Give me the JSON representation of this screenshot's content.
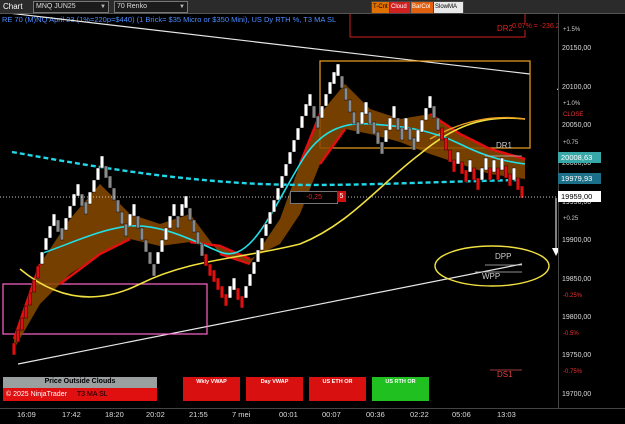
{
  "topbar": {
    "chart_tab": "Chart",
    "instrument": "MNQ JUN25",
    "bar_type": "70 Renko",
    "toolbar_buttons": [
      {
        "label": "T-Cnt",
        "bg": "#e07000",
        "fg": "#000"
      },
      {
        "label": "Cloud",
        "bg": "#d02020",
        "fg": "#fff"
      },
      {
        "label": "BarCol",
        "bg": "#e06010",
        "fg": "#fff"
      },
      {
        "label": "SlowMA",
        "bg": "#e8e8e8",
        "fg": "#000"
      }
    ]
  },
  "subtitle": "RE 70 (M)NQ April 23 (1%=220p=$440) (1 Brick= $35 Micro or $350 Mini), US Dy RTH %, T3 MA SL",
  "top_right": {
    "label": "0.07% = -236.25",
    "dr2": "DR2"
  },
  "price_axis": {
    "labels": [
      "20150,00",
      "20100,00",
      "20050,00",
      "20000,00",
      "19950,00",
      "19900,00",
      "19850,00",
      "19800,00",
      "19750,00",
      "19700,00"
    ]
  },
  "pct_labels": {
    "green": [
      "+1.5%",
      "+1.0%",
      "+0.75",
      "+0.5",
      "+0.25"
    ],
    "red": [
      "-0.25%",
      "-0.5%",
      "-0.75%"
    ],
    "close": "CLOSE"
  },
  "price_boxes": [
    {
      "value": "20008,63",
      "bg": "#37a7a7"
    },
    {
      "value": "19979,93",
      "bg": "#1b6f86"
    },
    {
      "value": "19959,00",
      "bg": "#ffffff",
      "fg": "#000"
    }
  ],
  "levels": {
    "dr1": "DR1",
    "dpp": "DPP",
    "wpp": "WPP",
    "ds1": "DS1"
  },
  "marker": {
    "value": "-0,25",
    "num": "5"
  },
  "time_axis": [
    "16:09",
    "17:42",
    "18:20",
    "20:02",
    "21:55",
    "7 mei",
    "00:01",
    "00:07",
    "00:36",
    "02:22",
    "05:06",
    "13:03"
  ],
  "panels": [
    {
      "label": "Price Outside Clouds",
      "bg": "#9aa0a0"
    },
    {
      "label": "Wkly VWAP",
      "bg": "#d81010"
    },
    {
      "label": "Day VWAP",
      "bg": "#d81010"
    },
    {
      "label": "US ETH OR",
      "bg": "#d81010"
    },
    {
      "label": "US RTH OR",
      "bg": "#20c020"
    }
  ],
  "copyright": "© 2025 NinjaTrader",
  "copyright_tag": "T3 MA SL"
}
